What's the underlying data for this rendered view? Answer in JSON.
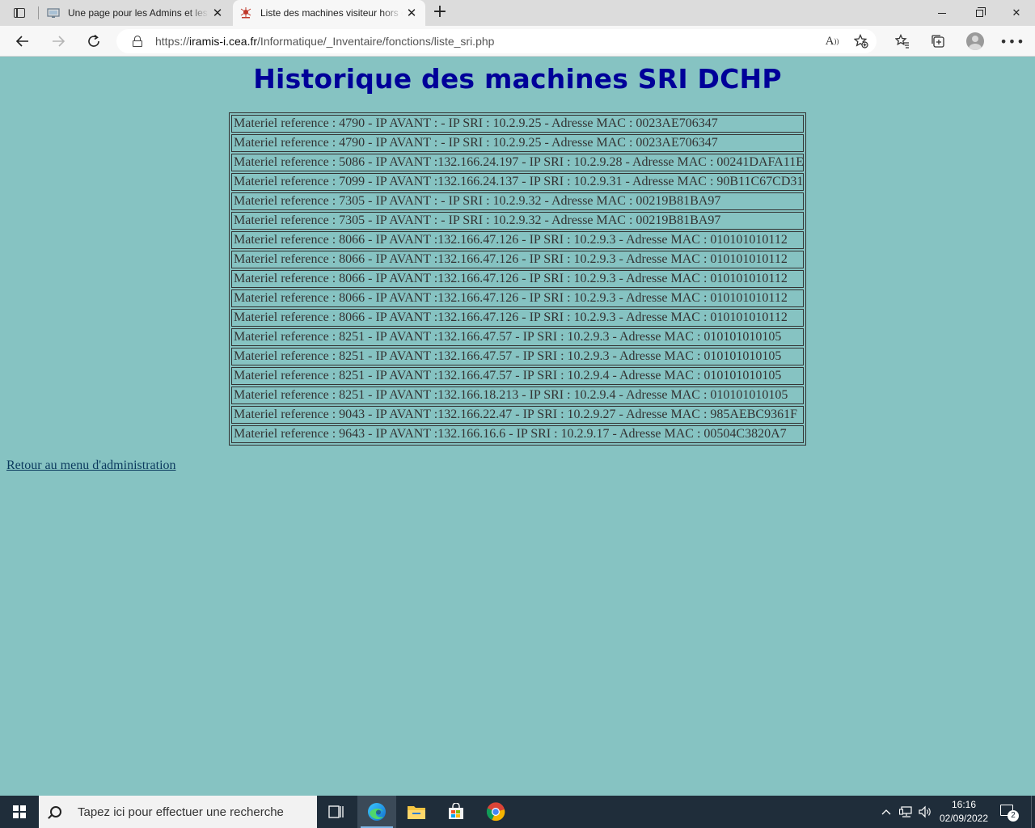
{
  "browser": {
    "tabs": [
      {
        "title": "Une page pour les Admins et les",
        "active": false
      },
      {
        "title": "Liste des machines visiteur hors c",
        "active": true
      }
    ],
    "url_prefix": "https://",
    "url_host": "iramis-i.cea.fr",
    "url_path": "/Informatique/_Inventaire/fonctions/liste_sri.php",
    "read_aloud_label": "A"
  },
  "page": {
    "title": "Historique des machines SRI DCHP",
    "records": [
      "Materiel reference : 4790 - IP AVANT : - IP SRI : 10.2.9.25 - Adresse MAC : 0023AE706347",
      "Materiel reference : 4790 - IP AVANT : - IP SRI : 10.2.9.25 - Adresse MAC : 0023AE706347",
      "Materiel reference : 5086 - IP AVANT :132.166.24.197 - IP SRI : 10.2.9.28 - Adresse MAC : 00241DAFA11E",
      "Materiel reference : 7099 - IP AVANT :132.166.24.137 - IP SRI : 10.2.9.31 - Adresse MAC : 90B11C67CD31",
      "Materiel reference : 7305 - IP AVANT : - IP SRI : 10.2.9.32 - Adresse MAC : 00219B81BA97",
      "Materiel reference : 7305 - IP AVANT : - IP SRI : 10.2.9.32 - Adresse MAC : 00219B81BA97",
      "Materiel reference : 8066 - IP AVANT :132.166.47.126 - IP SRI : 10.2.9.3 - Adresse MAC : 010101010112",
      "Materiel reference : 8066 - IP AVANT :132.166.47.126 - IP SRI : 10.2.9.3 - Adresse MAC : 010101010112",
      "Materiel reference : 8066 - IP AVANT :132.166.47.126 - IP SRI : 10.2.9.3 - Adresse MAC : 010101010112",
      "Materiel reference : 8066 - IP AVANT :132.166.47.126 - IP SRI : 10.2.9.3 - Adresse MAC : 010101010112",
      "Materiel reference : 8066 - IP AVANT :132.166.47.126 - IP SRI : 10.2.9.3 - Adresse MAC : 010101010112",
      "Materiel reference : 8251 - IP AVANT :132.166.47.57 - IP SRI : 10.2.9.3 - Adresse MAC : 010101010105",
      "Materiel reference : 8251 - IP AVANT :132.166.47.57 - IP SRI : 10.2.9.3 - Adresse MAC : 010101010105",
      "Materiel reference : 8251 - IP AVANT :132.166.47.57 - IP SRI : 10.2.9.4 - Adresse MAC : 010101010105",
      "Materiel reference : 8251 - IP AVANT :132.166.18.213 - IP SRI : 10.2.9.4 - Adresse MAC : 010101010105",
      "Materiel reference : 9043 - IP AVANT :132.166.22.47 - IP SRI : 10.2.9.27 - Adresse MAC : 985AEBC9361F",
      "Materiel reference : 9643 - IP AVANT :132.166.16.6 - IP SRI : 10.2.9.17 - Adresse MAC : 00504C3820A7"
    ],
    "back_link": "Retour au menu d'administration"
  },
  "taskbar": {
    "search_placeholder": "Tapez ici pour effectuer une recherche",
    "time": "16:16",
    "date": "02/09/2022",
    "notification_count": "2"
  },
  "colors": {
    "page_background": "#86c3c2",
    "title": "#000099",
    "taskbar": "#1f2d3a"
  }
}
